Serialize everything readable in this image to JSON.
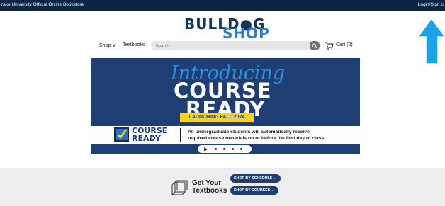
{
  "topbar": {
    "store_name": "rake University Official Online Bookstore",
    "login_label": "Login/Sign U"
  },
  "logo": {
    "line1": "BULLD●G",
    "line2": "SHOP"
  },
  "nav": {
    "shop_label": "Shop ∨",
    "textbooks_label": "Textbooks",
    "search_placeholder": "Search",
    "cart_label": "Cart (0)"
  },
  "banner": {
    "intro": "Introducing",
    "course": "COURSE",
    "ready": "READY",
    "launch": "LAUNCHING FALL 2024",
    "course_ready_logo_line1": "COURSE",
    "course_ready_logo_line2": "READY",
    "description_line1": "All undergraduate students will automatically receive",
    "description_line2": "required course materials on or before the first day of class."
  },
  "textbooks_section": {
    "heading_line1": "Get Your",
    "heading_line2": "Textbooks",
    "shop_by_schedule": "SHOP BY SCHEDULE →",
    "shop_by_courses": "SHOP BY COURSES →"
  },
  "colors": {
    "navy": "#0c2545",
    "banner_blue": "#1f3e73",
    "accent_blue": "#2a7bd1",
    "yellow": "#f5d324",
    "arrow_cyan": "#1aa3e8"
  },
  "icons": [
    "chevron-down-icon",
    "search-icon",
    "cart-icon",
    "checkbox-icon",
    "play-icon",
    "book-icon",
    "arrow-up-icon"
  ]
}
